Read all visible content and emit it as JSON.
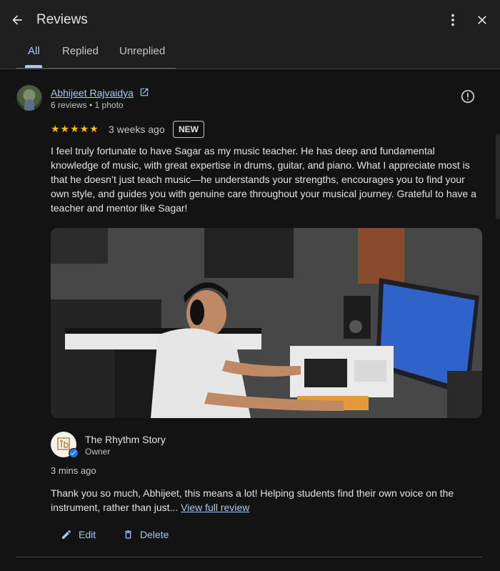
{
  "header": {
    "title": "Reviews",
    "back_icon": "arrow-left-icon",
    "more_icon": "more-vert-icon",
    "close_icon": "close-icon"
  },
  "tabs": [
    {
      "label": "All",
      "active": true
    },
    {
      "label": "Replied",
      "active": false
    },
    {
      "label": "Unreplied",
      "active": false
    }
  ],
  "review": {
    "reviewer_name": "Abhijeet Rajvaidya",
    "reviewer_meta": "6 reviews • 1 photo",
    "rating": 5,
    "stars": "★★★★★",
    "date": "3 weeks ago",
    "badge": "NEW",
    "text": "I feel truly fortunate to have Sagar as my music teacher. He has deep and fundamental knowledge of music, with great expertise in drums, guitar, and piano. What I appreciate most is that he doesn’t just teach music—he understands your strengths, encourages you to find your own style, and guides you with genuine care throughout your musical journey. Grateful to have a teacher and mentor like Sagar!"
  },
  "reply": {
    "owner_name": "The Rhythm Story",
    "owner_role": "Owner",
    "date": "3 mins ago",
    "text": "Thank you so much, Abhijeet, this means a lot! Helping students find their own voice on the instrument, rather than just...",
    "view_full_label": "View full review",
    "edit_label": "Edit",
    "delete_label": "Delete"
  },
  "colors": {
    "accent": "#a8c7fa",
    "star": "#fbbc04",
    "background": "#131313",
    "header_bg": "#1f1f1f",
    "verified": "#1a73e8"
  }
}
